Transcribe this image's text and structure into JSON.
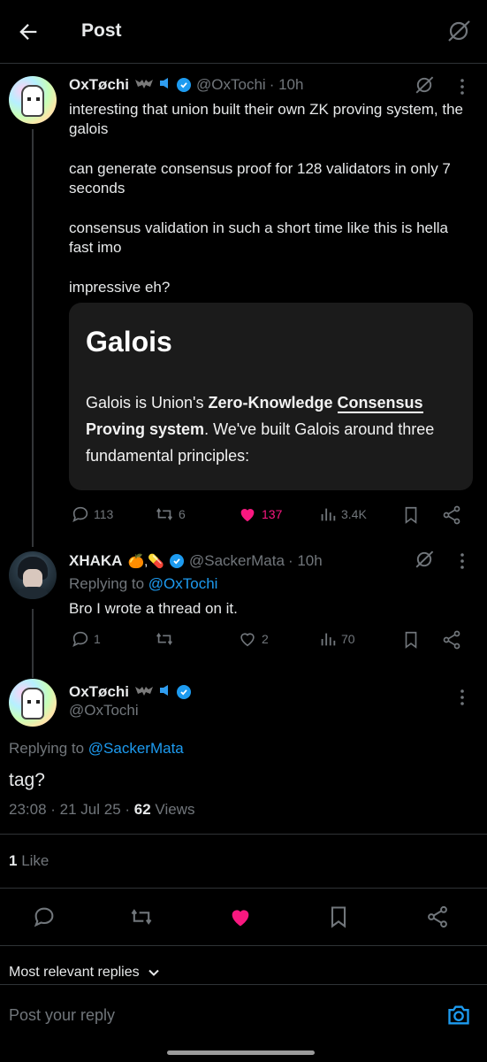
{
  "header": {
    "title": "Post"
  },
  "post": {
    "author_name": "OxTøchi",
    "handle": "@OxTochi",
    "time": "· 10h",
    "paragraphs": [
      "interesting that union built their own ZK proving system, the galois",
      "can generate consensus proof for 128 validators in only 7 seconds",
      "consensus validation in  such a short time like this  is hella fast imo",
      "impressive eh?"
    ],
    "card": {
      "title": "Galois",
      "body_prefix": "Galois is Union's ",
      "body_bold1": "Zero-Knowledge ",
      "body_bold2": "Consensus",
      "body_bold3": "Proving system",
      "body_suffix": ". We've built Galois around three fundamental principles:"
    },
    "counts": {
      "replies": "113",
      "reposts": "6",
      "likes": "137",
      "views": "3.4K"
    }
  },
  "reply1": {
    "author_name": "XHAKA",
    "author_emoji": "🍊,💊",
    "handle": "@SackerMata",
    "time": "· 10h",
    "replying_prefix": "Replying to",
    "replying_to": "@OxTochi",
    "text": "Bro I wrote a thread on it.",
    "counts": {
      "replies": "1",
      "reposts": "",
      "likes": "2",
      "views": "70"
    }
  },
  "main": {
    "author_name": "OxTøchi",
    "handle": "@OxTochi",
    "replying_prefix": "Replying to",
    "replying_to": "@SackerMata",
    "text": "tag?",
    "timestamp": "23:08 · 21 Jul 25 · ",
    "views_count": "62",
    "views_label": " Views",
    "likes_count": "1",
    "likes_label": " Like"
  },
  "sort": {
    "label": "Most relevant replies"
  },
  "compose": {
    "placeholder": "Post your reply"
  },
  "colors": {
    "accent": "#1d9bf0",
    "like": "#f91880",
    "muted": "#71767b",
    "bg": "#000000"
  }
}
